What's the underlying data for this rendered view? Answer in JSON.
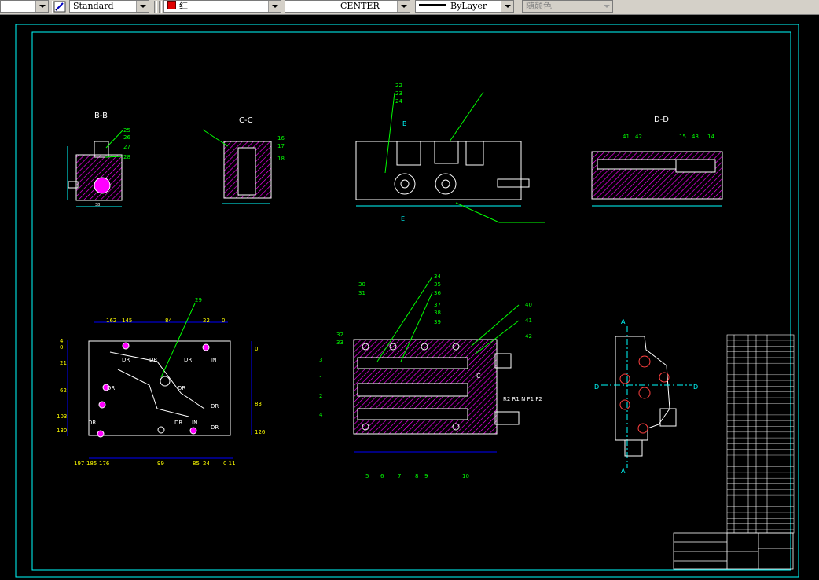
{
  "toolbar": {
    "layer_combo_value": "",
    "text_style_value": "Standard",
    "color_value": "红",
    "color_hex": "#e00000",
    "linetype_value": "CENTER",
    "lineweight_value": "ByLayer",
    "plotstyle_value": "随颜色"
  },
  "drawing": {
    "view_bb": "B-B",
    "view_cc": "C-C",
    "view_dd": "D-D",
    "label_b": "B",
    "label_e": "E",
    "label_a": "A",
    "label_c": "C",
    "label_d": "D",
    "dim_62": "62",
    "dim_103": "103",
    "dim_130": "130",
    "dim_21": "21",
    "dim_4": "4",
    "dim_0": "0",
    "dim_162": "162",
    "dim_145": "145",
    "dim_84": "84",
    "dim_22": "22",
    "dim_0b": "0",
    "dim_197": "197",
    "dim_185": "185",
    "dim_176": "176",
    "dim_99": "99",
    "dim_85": "85",
    "dim_24": "24",
    "dim_011": "0 11",
    "dim_0r": "0",
    "dim_83": "83",
    "dim_126": "126",
    "dr": "DR",
    "in": "IN",
    "hydraulic_ports": "R2 R1 N F1 F2",
    "callouts_top": [
      "22",
      "23",
      "24"
    ],
    "callouts_bb": [
      "25",
      "26",
      "27",
      "28"
    ],
    "callouts_cc": [
      "16",
      "17",
      "18"
    ],
    "callouts_dd": [
      "41",
      "42",
      "15",
      "43",
      "14"
    ],
    "callouts_mid": [
      "30",
      "31",
      "34",
      "35",
      "36",
      "37",
      "38",
      "39",
      "40",
      "41",
      "42",
      "32",
      "33",
      "3",
      "1",
      "2",
      "4"
    ],
    "callouts_bottom": [
      "5",
      "6",
      "7",
      "8",
      "9",
      "10"
    ],
    "callout_29": "29"
  }
}
